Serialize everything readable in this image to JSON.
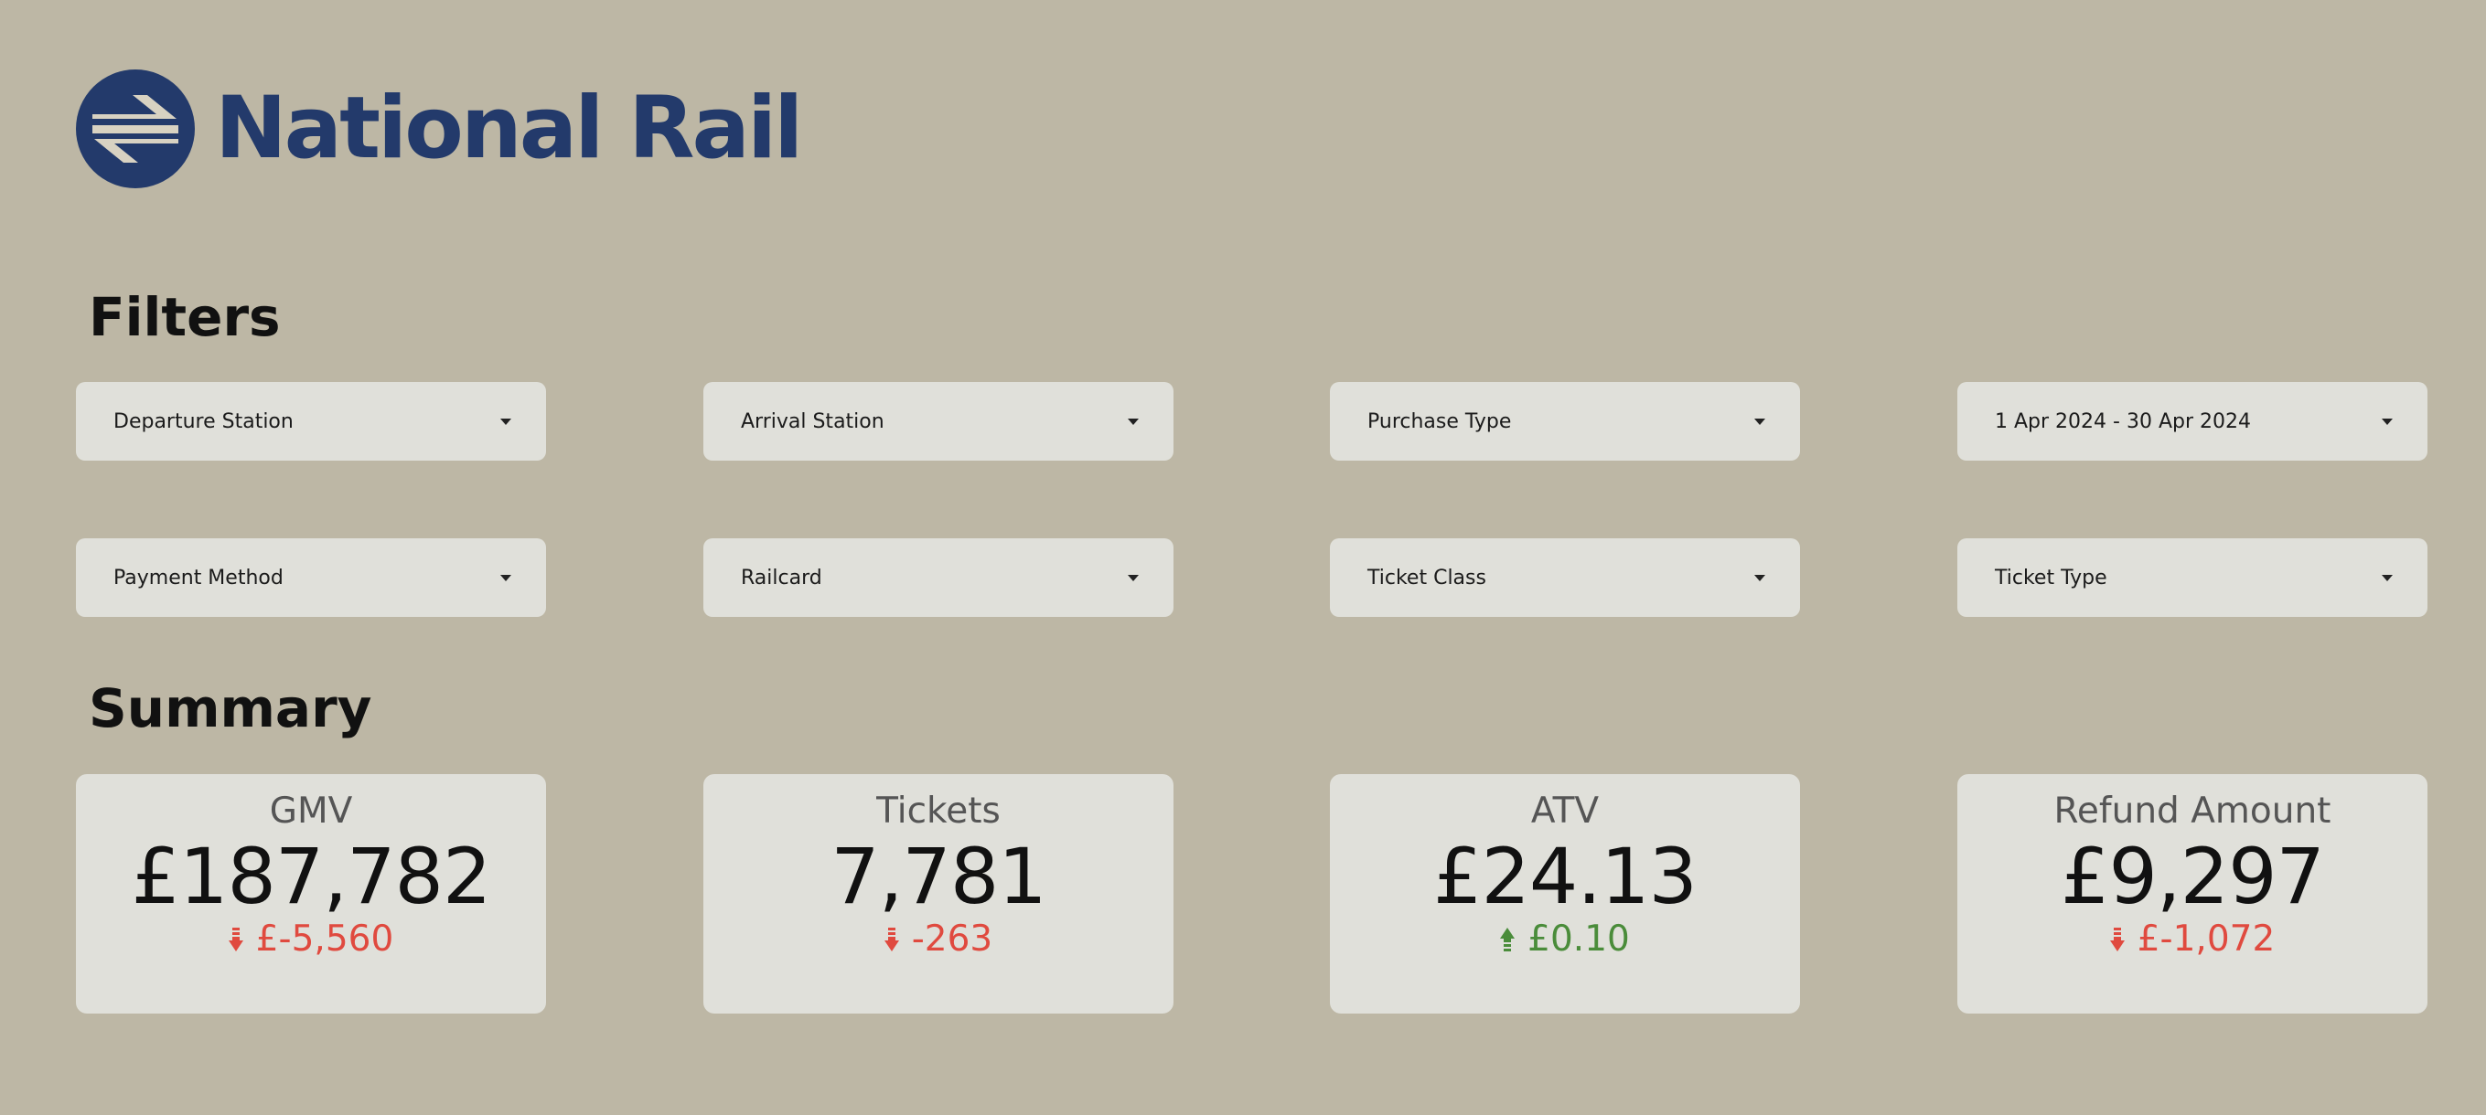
{
  "brand": {
    "name": "National Rail",
    "color": "#233a6b",
    "logo_icon": "double-arrow-icon"
  },
  "filters": {
    "heading": "Filters",
    "dropdowns": [
      {
        "label": "Departure Station"
      },
      {
        "label": "Arrival Station"
      },
      {
        "label": "Purchase Type"
      },
      {
        "label": "1 Apr 2024 - 30 Apr 2024"
      },
      {
        "label": "Payment Method"
      },
      {
        "label": "Railcard"
      },
      {
        "label": "Ticket Class"
      },
      {
        "label": "Ticket Type"
      }
    ]
  },
  "summary": {
    "heading": "Summary",
    "cards": [
      {
        "title": "GMV",
        "value": "£187,782",
        "delta": "£-5,560",
        "direction": "down"
      },
      {
        "title": "Tickets",
        "value": "7,781",
        "delta": "-263",
        "direction": "down"
      },
      {
        "title": "ATV",
        "value": "£24.13",
        "delta": "£0.10",
        "direction": "up"
      },
      {
        "title": "Refund Amount",
        "value": "£9,297",
        "delta": "£-1,072",
        "direction": "down"
      }
    ]
  },
  "colors": {
    "background": "#bdb7a5",
    "panel": "#e0e0da",
    "negative": "#e04a3f",
    "positive": "#4a8c3a"
  }
}
